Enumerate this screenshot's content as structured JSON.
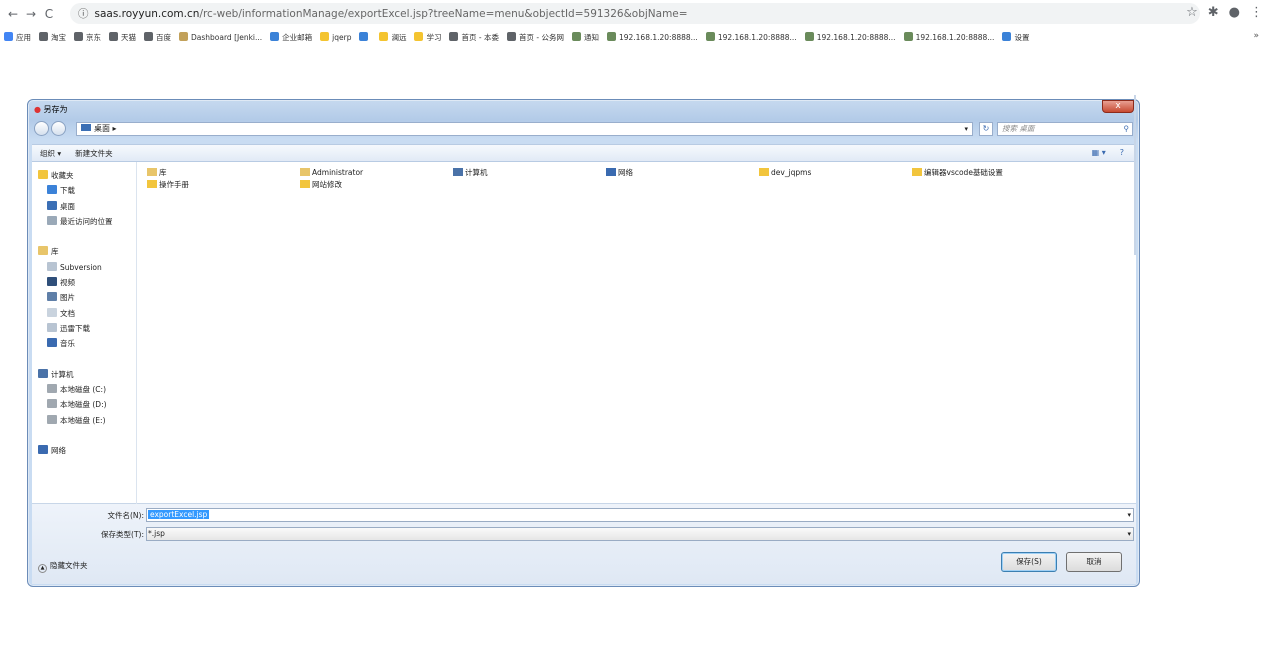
{
  "browser": {
    "url_host": "saas.royyun.com.cn",
    "url_path": "/rc-web/informationManage/exportExcel.jsp?treeName=menu&objectId=591326&objName=",
    "bookmarks": [
      {
        "label": "应用",
        "color": "#4285f4"
      },
      {
        "label": "淘宝",
        "color": "#5f6368"
      },
      {
        "label": "京东",
        "color": "#5f6368"
      },
      {
        "label": "天猫",
        "color": "#5f6368"
      },
      {
        "label": "百度",
        "color": "#5f6368"
      },
      {
        "label": "Dashboard [Jenki...",
        "color": "#c2a15a"
      },
      {
        "label": "企业邮箱",
        "color": "#3b82d8"
      },
      {
        "label": "jqerp",
        "color": "#f4c430"
      },
      {
        "label": "",
        "color": "#3b82d8"
      },
      {
        "label": "澜远",
        "color": "#f4c430"
      },
      {
        "label": "学习",
        "color": "#f4c430"
      },
      {
        "label": "首页 - 本委",
        "color": "#5f6368"
      },
      {
        "label": "首页 - 公务网",
        "color": "#5f6368"
      },
      {
        "label": "通知",
        "color": "#6a8b5b"
      },
      {
        "label": "192.168.1.20:8888...",
        "color": "#6a8b5b"
      },
      {
        "label": "192.168.1.20:8888...",
        "color": "#6a8b5b"
      },
      {
        "label": "192.168.1.20:8888...",
        "color": "#6a8b5b"
      },
      {
        "label": "192.168.1.20:8888...",
        "color": "#6a8b5b"
      },
      {
        "label": "设置",
        "color": "#3b82d8"
      }
    ],
    "more": "»"
  },
  "dialog": {
    "title": "另存为",
    "close": "x",
    "breadcrumb": "桌面  ▸",
    "search_placeholder": "搜索 桌面",
    "organize": "组织 ▾",
    "new_folder": "新建文件夹",
    "nav": [
      {
        "label": "收藏夹",
        "color": "#f2c53d",
        "indent": 0
      },
      {
        "label": "下载",
        "color": "#3b82d8",
        "indent": 1
      },
      {
        "label": "桌面",
        "color": "#3b6fb5",
        "indent": 1
      },
      {
        "label": "最近访问的位置",
        "color": "#9aa9b8",
        "indent": 1
      },
      {
        "label": "",
        "color": "",
        "indent": 0
      },
      {
        "label": "库",
        "color": "#e8c56a",
        "indent": 0
      },
      {
        "label": "Subversion",
        "color": "#b8c4d2",
        "indent": 1
      },
      {
        "label": "视频",
        "color": "#2f4f7a",
        "indent": 1
      },
      {
        "label": "图片",
        "color": "#5f7fa8",
        "indent": 1
      },
      {
        "label": "文档",
        "color": "#c9d3de",
        "indent": 1
      },
      {
        "label": "迅雷下载",
        "color": "#b8c4d2",
        "indent": 1
      },
      {
        "label": "音乐",
        "color": "#3a6ab0",
        "indent": 1
      },
      {
        "label": "",
        "color": "",
        "indent": 0
      },
      {
        "label": "计算机",
        "color": "#4a72a8",
        "indent": 0
      },
      {
        "label": "本地磁盘 (C:)",
        "color": "#a0a8b0",
        "indent": 1
      },
      {
        "label": "本地磁盘 (D:)",
        "color": "#a0a8b0",
        "indent": 1
      },
      {
        "label": "本地磁盘 (E:)",
        "color": "#a0a8b0",
        "indent": 1
      },
      {
        "label": "",
        "color": "",
        "indent": 0
      },
      {
        "label": "网络",
        "color": "#3a6ab0",
        "indent": 0
      }
    ],
    "items": [
      {
        "label": "库",
        "color": "#e8c56a"
      },
      {
        "label": "Administrator",
        "color": "#e8c56a"
      },
      {
        "label": "计算机",
        "color": "#4a72a8"
      },
      {
        "label": "网络",
        "color": "#3a6ab0"
      },
      {
        "label": "dev_jqpms",
        "color": "#f2c53d"
      },
      {
        "label": "编辑器vscode基础设置",
        "color": "#f2c53d"
      },
      {
        "label": "操作手册",
        "color": "#f2c53d"
      },
      {
        "label": "网站修改",
        "color": "#f2c53d"
      }
    ],
    "filename_label": "文件名(N):",
    "filename": "exportExcel.jsp",
    "filetype_label": "保存类型(T):",
    "filetype": "*.jsp",
    "hide_folders": "隐藏文件夹",
    "save": "保存(S)",
    "cancel": "取消"
  }
}
